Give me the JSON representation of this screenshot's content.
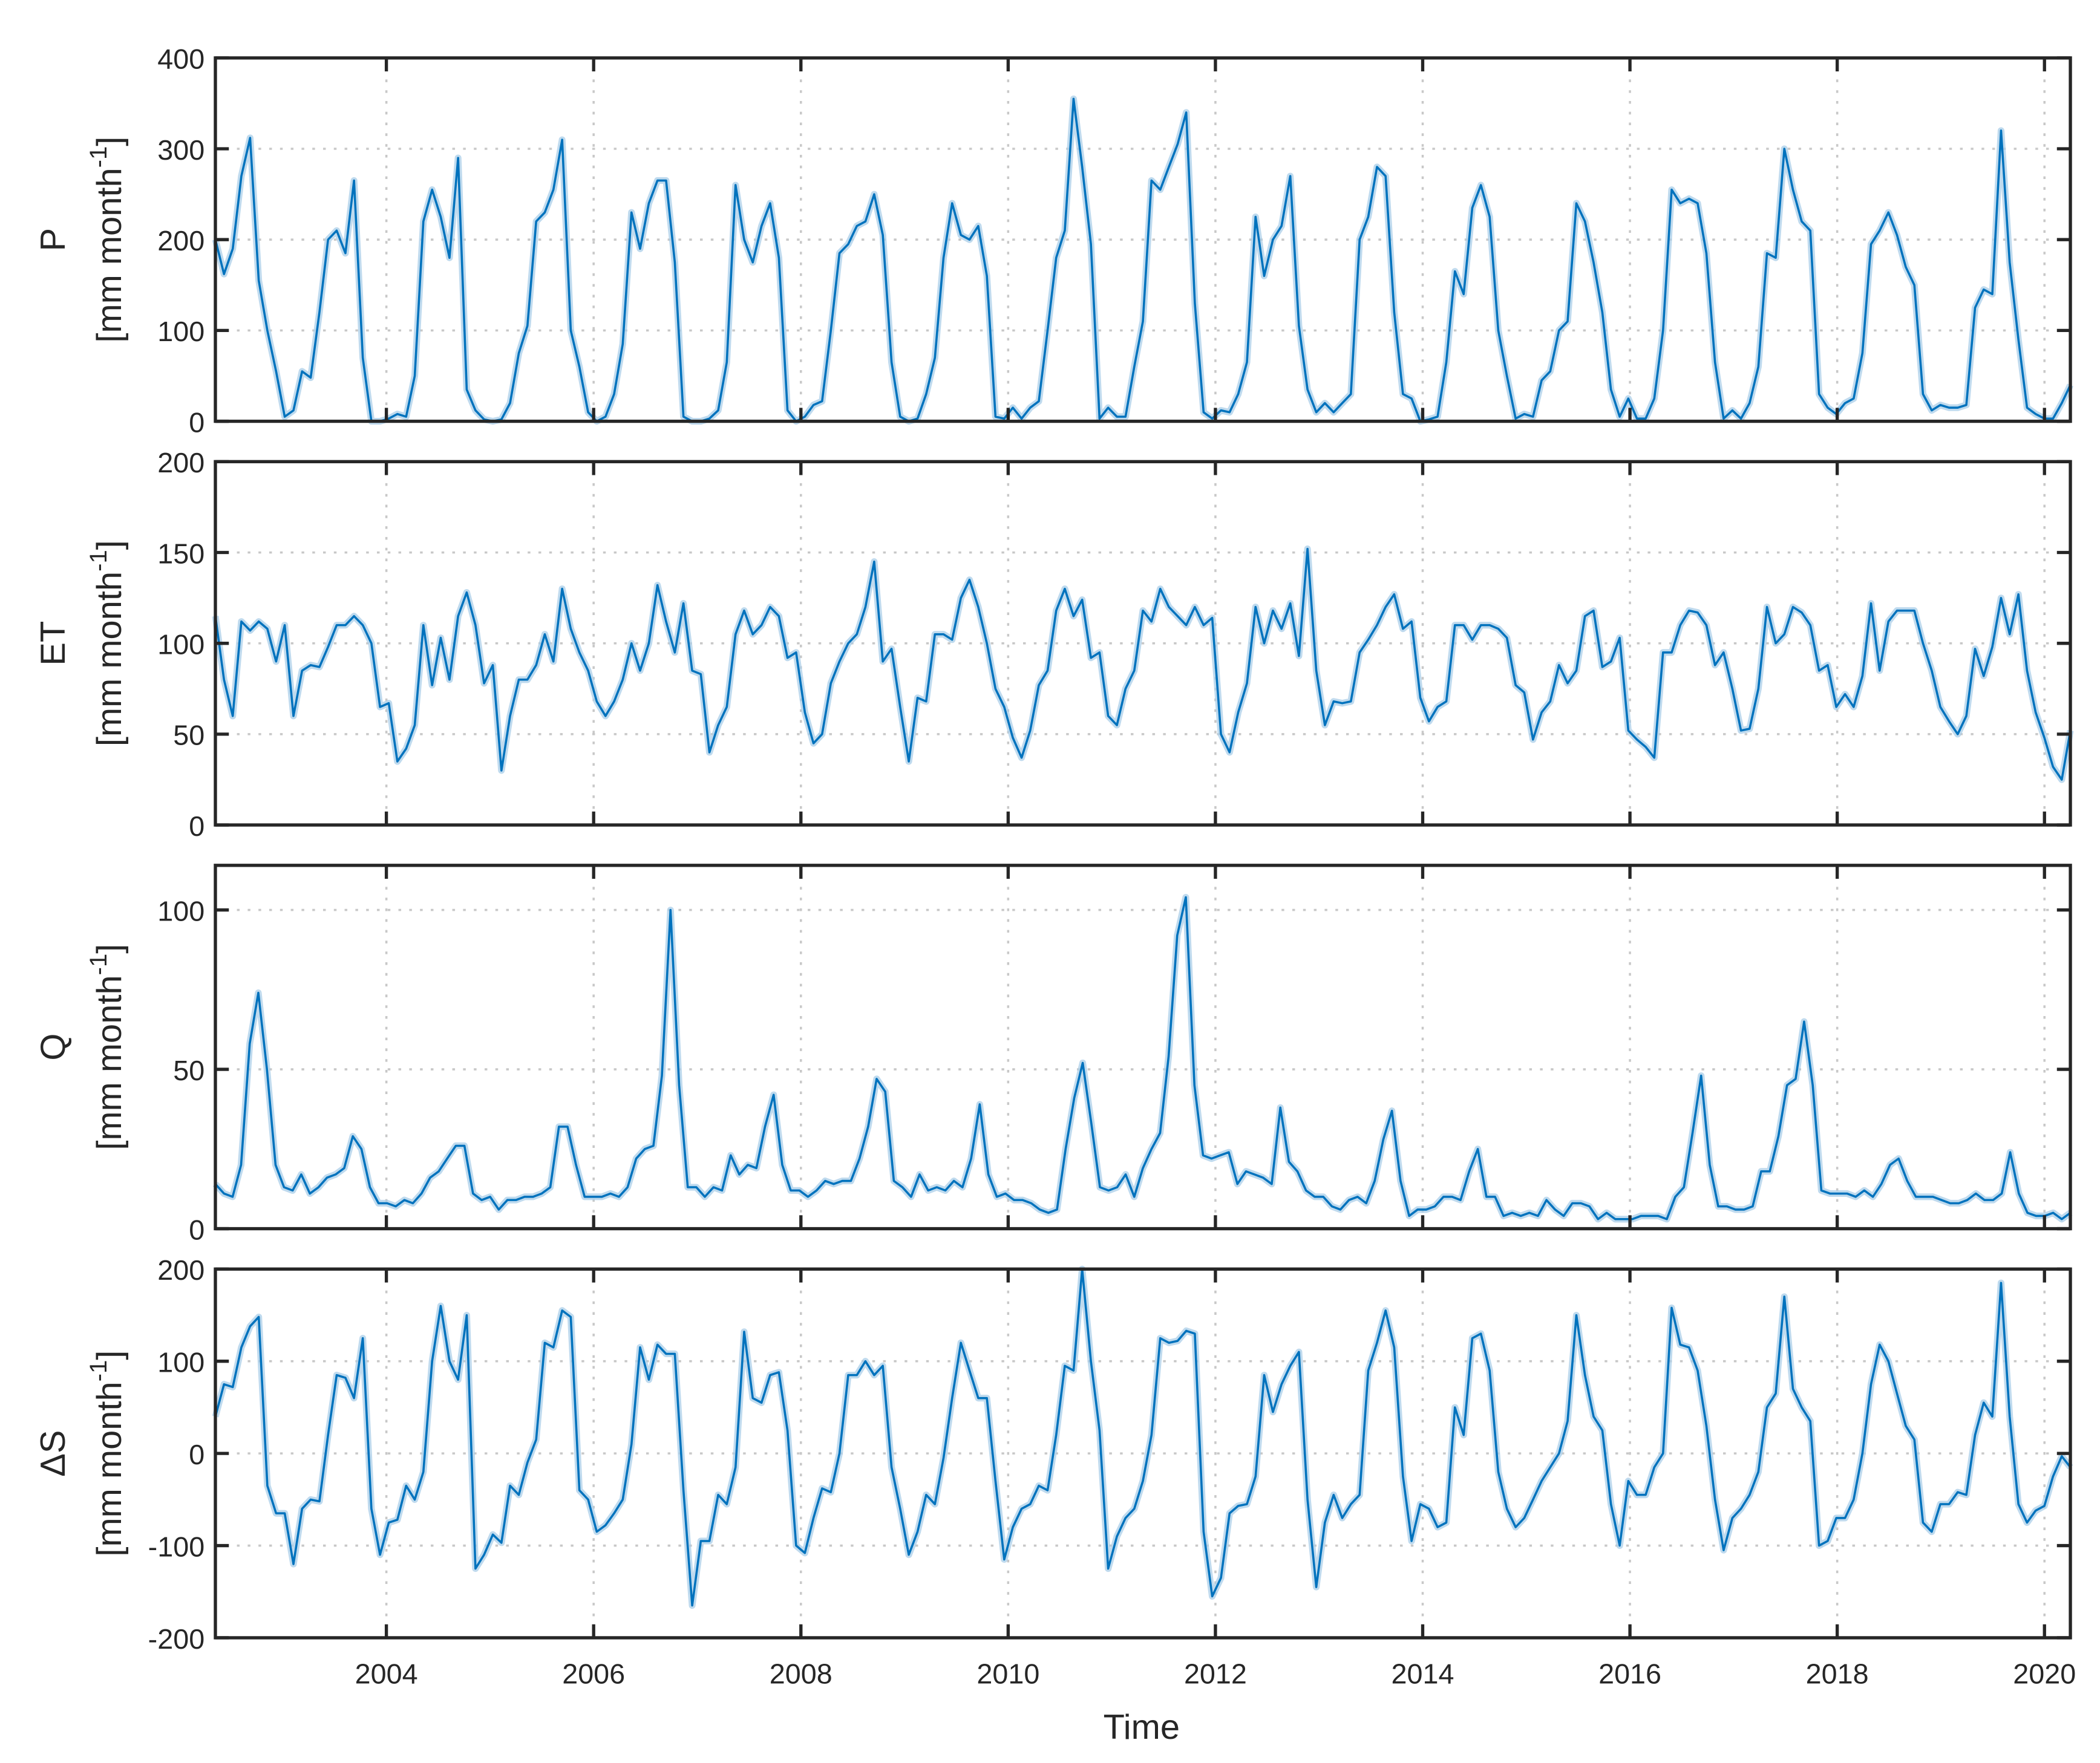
{
  "chart_data": {
    "type": "line",
    "xlabel": "Time",
    "xlim": [
      2002.35,
      2020.25
    ],
    "x_ticks": [
      "2004",
      "2006",
      "2008",
      "2010",
      "2012",
      "2014",
      "2016",
      "2018",
      "2020"
    ],
    "series_time_range": [
      2002.35,
      2020.25
    ],
    "sampling": "monthly",
    "grid": true,
    "line_color": "#0072BD",
    "band_color": "#A9CDE8",
    "panels": [
      {
        "name": "P",
        "unit_prefix": "[mm month",
        "unit_sup": "-1",
        "unit_suffix": "]",
        "ylim": [
          0,
          400
        ],
        "y_ticks": [
          "0",
          "100",
          "200",
          "300",
          "400"
        ],
        "values": [
          200,
          162,
          190,
          270,
          312,
          155,
          100,
          55,
          5,
          12,
          55,
          48,
          120,
          200,
          210,
          185,
          265,
          70,
          0,
          0,
          3,
          8,
          5,
          50,
          220,
          255,
          225,
          180,
          290,
          35,
          12,
          2,
          0,
          2,
          20,
          75,
          105,
          220,
          230,
          255,
          310,
          100,
          60,
          10,
          0,
          5,
          30,
          85,
          230,
          190,
          240,
          265,
          265,
          175,
          5,
          0,
          0,
          3,
          12,
          65,
          260,
          200,
          175,
          215,
          240,
          180,
          12,
          0,
          5,
          18,
          22,
          100,
          185,
          195,
          215,
          220,
          250,
          205,
          65,
          5,
          0,
          3,
          30,
          70,
          180,
          240,
          205,
          200,
          215,
          160,
          5,
          3,
          15,
          3,
          15,
          22,
          100,
          180,
          210,
          355,
          280,
          195,
          3,
          15,
          5,
          5,
          60,
          110,
          265,
          255,
          280,
          305,
          340,
          130,
          10,
          3,
          12,
          10,
          30,
          65,
          225,
          160,
          200,
          215,
          270,
          105,
          35,
          10,
          20,
          10,
          20,
          30,
          200,
          225,
          280,
          270,
          120,
          30,
          25,
          0,
          2,
          5,
          65,
          165,
          140,
          235,
          260,
          225,
          100,
          50,
          3,
          8,
          5,
          45,
          55,
          100,
          110,
          240,
          220,
          175,
          120,
          35,
          5,
          25,
          3,
          3,
          25,
          100,
          255,
          240,
          245,
          240,
          185,
          65,
          3,
          12,
          3,
          20,
          60,
          185,
          180,
          300,
          255,
          220,
          210,
          30,
          15,
          8,
          20,
          25,
          75,
          195,
          210,
          230,
          205,
          170,
          150,
          30,
          12,
          18,
          15,
          15,
          18,
          125,
          145,
          140,
          320,
          175,
          90,
          15,
          8,
          3,
          3,
          20,
          40
        ]
      },
      {
        "name": "ET",
        "unit_prefix": "[mm month",
        "unit_sup": "-1",
        "unit_suffix": "]",
        "ylim": [
          0,
          200
        ],
        "y_ticks": [
          "0",
          "50",
          "100",
          "150",
          "200"
        ],
        "values": [
          115,
          80,
          60,
          112,
          107,
          112,
          108,
          90,
          110,
          60,
          85,
          88,
          87,
          98,
          110,
          110,
          115,
          110,
          100,
          65,
          67,
          35,
          42,
          55,
          110,
          77,
          103,
          80,
          115,
          128,
          110,
          78,
          88,
          30,
          60,
          80,
          80,
          88,
          105,
          90,
          130,
          108,
          95,
          85,
          68,
          60,
          68,
          80,
          100,
          85,
          100,
          132,
          112,
          95,
          122,
          85,
          83,
          40,
          55,
          65,
          105,
          118,
          105,
          110,
          120,
          115,
          92,
          95,
          62,
          45,
          50,
          78,
          90,
          100,
          105,
          120,
          145,
          90,
          97,
          65,
          35,
          70,
          68,
          105,
          105,
          102,
          125,
          135,
          120,
          100,
          75,
          65,
          48,
          37,
          52,
          77,
          85,
          118,
          130,
          115,
          124,
          92,
          95,
          60,
          55,
          75,
          85,
          118,
          112,
          130,
          120,
          115,
          110,
          120,
          110,
          114,
          50,
          40,
          62,
          78,
          120,
          100,
          118,
          108,
          122,
          93,
          152,
          85,
          55,
          68,
          67,
          68,
          95,
          102,
          110,
          120,
          127,
          108,
          112,
          70,
          57,
          65,
          68,
          110,
          110,
          102,
          110,
          110,
          108,
          103,
          77,
          73,
          47,
          62,
          68,
          88,
          78,
          85,
          115,
          118,
          87,
          90,
          103,
          52,
          47,
          43,
          37,
          95,
          95,
          110,
          118,
          117,
          110,
          88,
          95,
          75,
          52,
          53,
          75,
          120,
          100,
          105,
          120,
          117,
          110,
          85,
          88,
          65,
          72,
          65,
          82,
          122,
          85,
          112,
          118,
          118,
          118,
          100,
          85,
          65,
          57,
          50,
          60,
          97,
          82,
          98,
          125,
          105,
          127,
          85,
          62,
          48,
          32,
          25,
          52
        ]
      },
      {
        "name": "Q",
        "unit_prefix": "[mm month",
        "unit_sup": "-1",
        "unit_suffix": "]",
        "ylim": [
          0,
          114
        ],
        "y_ticks": [
          "0",
          "50",
          "100"
        ],
        "y_tick_values": [
          0,
          50,
          100
        ],
        "values": [
          14,
          11,
          10,
          20,
          58,
          74,
          50,
          20,
          13,
          12,
          17,
          11,
          13,
          16,
          17,
          19,
          29,
          25,
          13,
          8,
          8,
          7,
          9,
          8,
          11,
          16,
          18,
          22,
          26,
          26,
          11,
          9,
          10,
          6,
          9,
          9,
          10,
          10,
          11,
          13,
          32,
          32,
          20,
          10,
          10,
          10,
          11,
          10,
          13,
          22,
          25,
          26,
          48,
          100,
          45,
          13,
          13,
          10,
          13,
          12,
          23,
          17,
          20,
          19,
          32,
          42,
          20,
          12,
          12,
          10,
          12,
          15,
          14,
          15,
          15,
          22,
          32,
          47,
          43,
          15,
          13,
          10,
          17,
          12,
          13,
          12,
          15,
          13,
          22,
          39,
          17,
          10,
          11,
          9,
          9,
          8,
          6,
          5,
          6,
          25,
          41,
          52,
          33,
          13,
          12,
          13,
          17,
          10,
          19,
          25,
          30,
          54,
          92,
          104,
          45,
          23,
          22,
          23,
          24,
          14,
          18,
          17,
          16,
          14,
          38,
          21,
          18,
          12,
          10,
          10,
          7,
          6,
          9,
          10,
          8,
          15,
          28,
          37,
          15,
          4,
          6,
          6,
          7,
          10,
          10,
          9,
          18,
          25,
          10,
          10,
          4,
          5,
          4,
          5,
          4,
          9,
          6,
          4,
          8,
          8,
          7,
          3,
          5,
          3,
          3,
          3,
          4,
          4,
          4,
          3,
          10,
          13,
          30,
          48,
          20,
          7,
          7,
          6,
          6,
          7,
          18,
          18,
          29,
          45,
          47,
          65,
          45,
          12,
          11,
          11,
          11,
          10,
          12,
          10,
          14,
          20,
          22,
          15,
          10,
          10,
          10,
          9,
          8,
          8,
          9,
          11,
          9,
          9,
          11,
          24,
          11,
          5,
          4,
          4,
          5,
          3,
          5
        ]
      },
      {
        "name": "ΔS",
        "unit_prefix": "[mm month",
        "unit_sup": "-1",
        "unit_suffix": "]",
        "ylim": [
          -200,
          200
        ],
        "y_ticks": [
          "-200",
          "-100",
          "0",
          "100",
          "200"
        ],
        "values": [
          40,
          75,
          72,
          115,
          138,
          148,
          -35,
          -65,
          -65,
          -120,
          -60,
          -50,
          -52,
          20,
          85,
          82,
          60,
          125,
          -60,
          -110,
          -75,
          -72,
          -35,
          -50,
          -20,
          100,
          160,
          100,
          80,
          150,
          -125,
          -110,
          -88,
          -97,
          -35,
          -45,
          -10,
          15,
          120,
          115,
          155,
          148,
          -40,
          -50,
          -85,
          -78,
          -65,
          -50,
          10,
          115,
          80,
          118,
          108,
          108,
          -40,
          -165,
          -95,
          -95,
          -45,
          -55,
          -15,
          132,
          60,
          55,
          85,
          88,
          25,
          -100,
          -108,
          -70,
          -38,
          -42,
          0,
          85,
          85,
          100,
          85,
          95,
          -15,
          -60,
          -110,
          -85,
          -45,
          -55,
          -5,
          60,
          120,
          90,
          60,
          60,
          -30,
          -115,
          -80,
          -60,
          -55,
          -35,
          -40,
          20,
          95,
          90,
          200,
          100,
          25,
          -125,
          -90,
          -70,
          -60,
          -30,
          20,
          125,
          120,
          122,
          133,
          130,
          -85,
          -155,
          -135,
          -65,
          -57,
          -55,
          -25,
          85,
          45,
          75,
          95,
          110,
          -50,
          -145,
          -75,
          -45,
          -70,
          -55,
          -45,
          90,
          120,
          155,
          115,
          -25,
          -95,
          -55,
          -60,
          -80,
          -75,
          50,
          20,
          125,
          130,
          90,
          -20,
          -60,
          -80,
          -70,
          -50,
          -30,
          -15,
          0,
          35,
          150,
          85,
          40,
          25,
          -55,
          -100,
          -30,
          -45,
          -45,
          -15,
          0,
          158,
          118,
          115,
          90,
          30,
          -50,
          -105,
          -70,
          -60,
          -45,
          -20,
          50,
          65,
          170,
          70,
          50,
          35,
          -100,
          -95,
          -70,
          -70,
          -50,
          0,
          75,
          118,
          100,
          65,
          30,
          15,
          -75,
          -85,
          -55,
          -55,
          -42,
          -45,
          20,
          55,
          40,
          185,
          40,
          -55,
          -75,
          -62,
          -57,
          -25,
          -3,
          -15
        ]
      }
    ]
  }
}
